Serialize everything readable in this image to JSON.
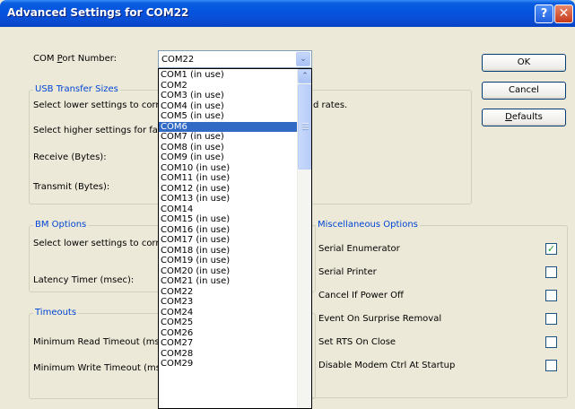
{
  "window": {
    "title": "Advanced Settings for COM22",
    "help_glyph": "?",
    "close_glyph": "✕"
  },
  "com_port": {
    "label_pre": "COM ",
    "label_accel": "P",
    "label_post": "ort Number:",
    "value": "COM22",
    "arrow": "⌄"
  },
  "usb": {
    "title": "USB Transfer Sizes",
    "line1_left": "Select lower settings to corre",
    "line1_right": "d rates.",
    "line2": "Select higher settings for fas",
    "receive_label": "Receive (Bytes):",
    "transmit_label": "Transmit (Bytes):"
  },
  "bm": {
    "title": "BM Options",
    "line1": "Select lower settings to corre",
    "latency_label": "Latency Timer (msec):"
  },
  "timeouts": {
    "title": "Timeouts",
    "read_label": "Minimum Read Timeout (msec",
    "write_label": "Minimum Write Timeout (mse"
  },
  "buttons": {
    "ok": "OK",
    "cancel": "Cancel",
    "defaults_accel": "D",
    "defaults_rest": "efaults"
  },
  "misc": {
    "title": "Miscellaneous Options",
    "options": [
      {
        "label": "Serial Enumerator",
        "checked": true
      },
      {
        "label": "Serial Printer",
        "checked": false
      },
      {
        "label": "Cancel If Power Off",
        "checked": false
      },
      {
        "label": "Event On Surprise Removal",
        "checked": false
      },
      {
        "label": "Set RTS On Close",
        "checked": false
      },
      {
        "label": "Disable Modem Ctrl At Startup",
        "checked": false
      }
    ]
  },
  "dropdown": {
    "items": [
      "COM1 (in use)",
      "COM2",
      "COM3 (in use)",
      "COM4 (in use)",
      "COM5 (in use)",
      "COM6",
      "COM7 (in use)",
      "COM8 (in use)",
      "COM9 (in use)",
      "COM10 (in use)",
      "COM11 (in use)",
      "COM12 (in use)",
      "COM13 (in use)",
      "COM14",
      "COM15 (in use)",
      "COM16 (in use)",
      "COM17 (in use)",
      "COM18 (in use)",
      "COM19 (in use)",
      "COM20 (in use)",
      "COM21 (in use)",
      "COM22",
      "COM23",
      "COM24",
      "COM25",
      "COM26",
      "COM27",
      "COM28",
      "COM29"
    ],
    "highlighted": "COM6",
    "scroll_up_glyph": "⌃"
  },
  "colors": {
    "group_title": "#0046d5",
    "highlight": "#316ac5",
    "check": "#21a121"
  }
}
